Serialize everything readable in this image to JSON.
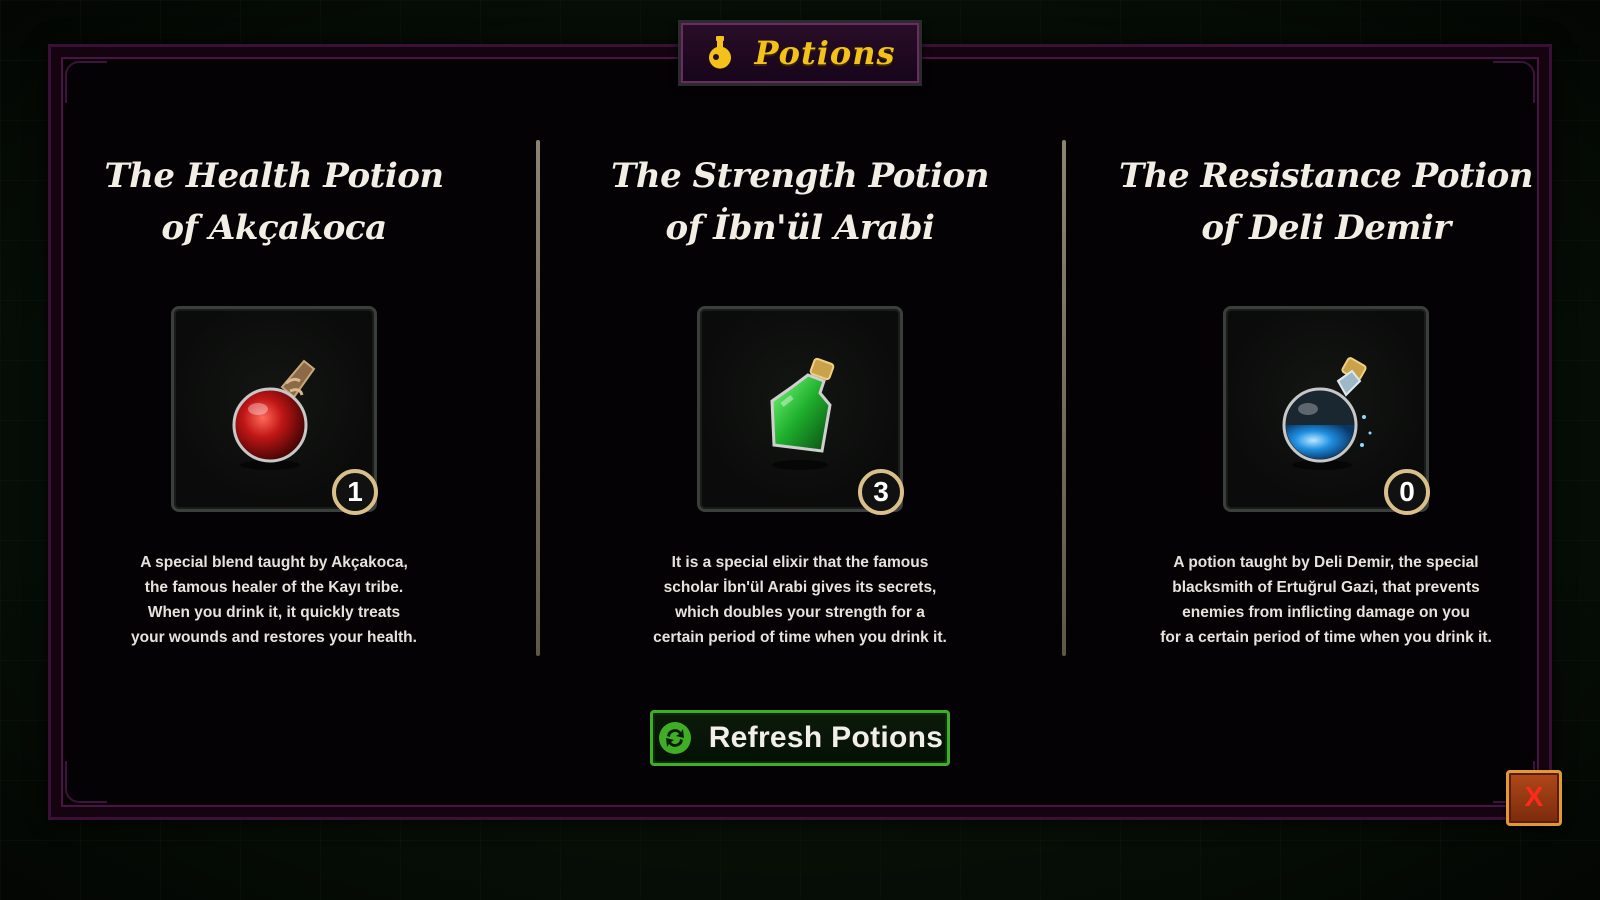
{
  "header": {
    "title": "Potions",
    "icon": "flask-icon",
    "accent_color": "#f2c21a"
  },
  "potions": [
    {
      "title_line1": "The Health Potion",
      "title_line2": "of Akçakoca",
      "icon": "red-potion-icon",
      "color": "#c11616",
      "count": "1",
      "desc": [
        "A special blend taught by Akçakoca,",
        "the famous healer of the Kayı tribe.",
        "When you drink it, it quickly treats",
        "your wounds and restores your health."
      ]
    },
    {
      "title_line1": "The Strength Potion",
      "title_line2": "of İbn'ül Arabi",
      "icon": "green-potion-icon",
      "color": "#1fae2d",
      "count": "3",
      "desc": [
        "It is a special elixir that the famous",
        "scholar İbn'ül Arabi gives its secrets,",
        "which doubles your strength for a",
        "certain period of time when you drink it."
      ]
    },
    {
      "title_line1": "The Resistance Potion",
      "title_line2": "of Deli Demir",
      "icon": "blue-potion-icon",
      "color": "#1e8fe0",
      "count": "0",
      "desc": [
        "A potion taught by Deli Demir, the special",
        "blacksmith of Ertuğrul Gazi, that prevents",
        "enemies from inflicting damage on you",
        "for a certain period of time when you drink it."
      ]
    }
  ],
  "actions": {
    "refresh_label": "Refresh Potions",
    "refresh_icon": "refresh-icon",
    "refresh_color": "#3fae24",
    "close_label": "X",
    "close_icon": "close-icon"
  }
}
